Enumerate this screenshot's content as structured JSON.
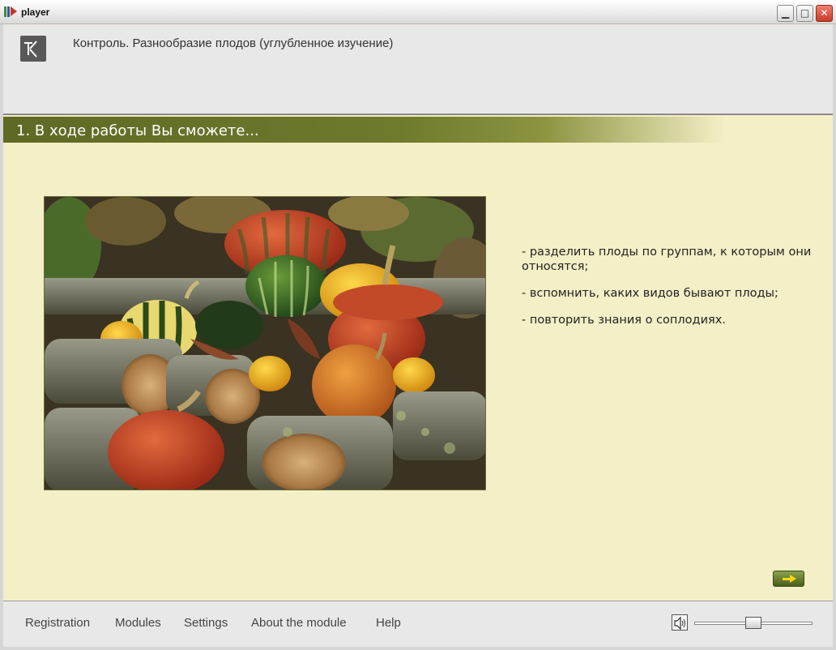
{
  "window": {
    "title": "player",
    "minimize_glyph": "▁",
    "maximize_glyph": "□",
    "close_glyph": "✕"
  },
  "header": {
    "title": "Контроль. Разнообразие плодов (углубленное изучение)"
  },
  "section": {
    "title": "1. В ходе работы Вы сможете..."
  },
  "goals": [
    "- разделить плоды по группам, к которым они относятся;",
    "- вспомнить, каких видов бывают плоды;",
    "- повторить знания о соплодиях."
  ],
  "footer": {
    "menu": [
      "Registration",
      "Modules",
      "Settings",
      "About the module",
      "Help"
    ],
    "volume": 0.5
  },
  "colors": {
    "accent_bar": "#6e7a2c",
    "content_bg": "#f3efc6",
    "arrow": "#f4d614"
  },
  "icons": {
    "app": "player-app-icon",
    "logo": "k-logo",
    "next": "arrow-right-icon",
    "volume": "speaker-icon"
  }
}
